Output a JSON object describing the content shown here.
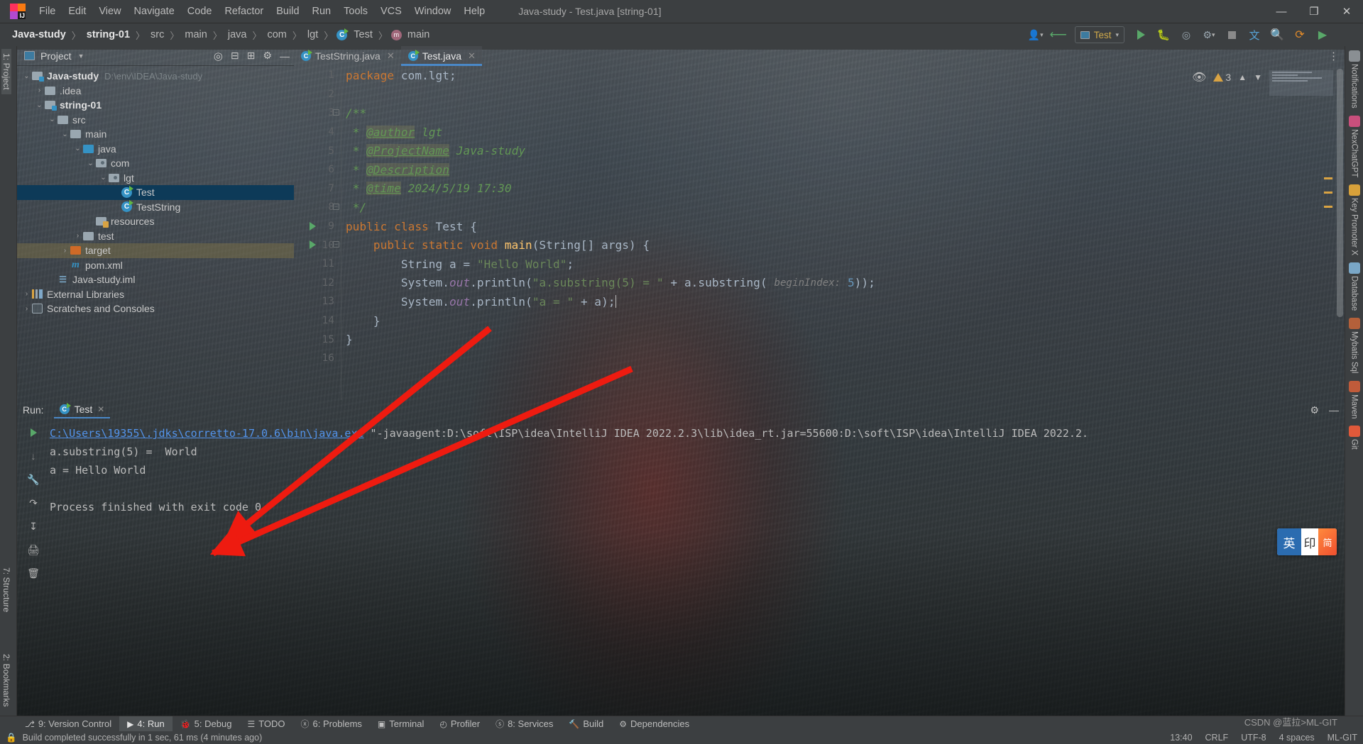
{
  "window": {
    "title": "Java-study - Test.java [string-01]",
    "minimize": "—",
    "maximize": "❐",
    "close": "✕"
  },
  "menubar": {
    "logo_text": "IJ",
    "items": [
      {
        "label": "File"
      },
      {
        "label": "Edit"
      },
      {
        "label": "View"
      },
      {
        "label": "Navigate"
      },
      {
        "label": "Code"
      },
      {
        "label": "Refactor"
      },
      {
        "label": "Build"
      },
      {
        "label": "Run"
      },
      {
        "label": "Tools"
      },
      {
        "label": "VCS"
      },
      {
        "label": "Window"
      },
      {
        "label": "Help"
      }
    ]
  },
  "breadcrumb": {
    "items": [
      "Java-study",
      "string-01",
      "src",
      "main",
      "java",
      "com",
      "lgt",
      "Test",
      "main"
    ],
    "separator": "〉"
  },
  "toolbar": {
    "run_config": "Test",
    "search_icon": "search-icon",
    "settings_icon": "gear-icon",
    "run_icon": "run-icon",
    "debug_icon": "debug-icon",
    "coverage_icon": "coverage-icon",
    "stop_icon": "stop-icon",
    "translate_icon": "translate-icon",
    "updates_icon": "updates-icon"
  },
  "left_strip": {
    "top_label": "1: Project",
    "bottom_labels": [
      "2: Bookmarks",
      "7: Structure"
    ]
  },
  "right_strip": {
    "items": [
      "Notifications",
      "NexChatGPT",
      "Key Promoter X",
      "Database",
      "Mybatis Sql",
      "Maven",
      "Git"
    ]
  },
  "project_panel": {
    "title": "Project",
    "chevron": "▼",
    "header_icons": [
      "locate-icon",
      "expand-all-icon",
      "collapse-all-icon",
      "settings-icon",
      "hide-icon"
    ],
    "tree": [
      {
        "label": "Java-study",
        "path": "D:\\env\\IDEA\\Java-study",
        "depth": 0,
        "twist": "⌄",
        "icon": "module-folder",
        "bold": true
      },
      {
        "label": ".idea",
        "path": "",
        "depth": 1,
        "twist": "›",
        "icon": "folder",
        "bold": false
      },
      {
        "label": "string-01",
        "path": "",
        "depth": 1,
        "twist": "⌄",
        "icon": "module-folder",
        "bold": true
      },
      {
        "label": "src",
        "path": "",
        "depth": 2,
        "twist": "⌄",
        "icon": "folder",
        "bold": false
      },
      {
        "label": "main",
        "path": "",
        "depth": 3,
        "twist": "⌄",
        "icon": "folder",
        "bold": false
      },
      {
        "label": "java",
        "path": "",
        "depth": 4,
        "twist": "⌄",
        "icon": "source-folder",
        "bold": false
      },
      {
        "label": "com",
        "path": "",
        "depth": 5,
        "twist": "⌄",
        "icon": "package-folder",
        "bold": false
      },
      {
        "label": "lgt",
        "path": "",
        "depth": 6,
        "twist": "⌄",
        "icon": "package-folder",
        "bold": false
      },
      {
        "label": "Test",
        "path": "",
        "depth": 7,
        "twist": "",
        "icon": "java-class",
        "bold": false,
        "selected": true
      },
      {
        "label": "TestString",
        "path": "",
        "depth": 7,
        "twist": "",
        "icon": "java-class",
        "bold": false
      },
      {
        "label": "resources",
        "path": "",
        "depth": 5,
        "twist": "",
        "icon": "resources-folder",
        "bold": false
      },
      {
        "label": "test",
        "path": "",
        "depth": 4,
        "twist": "›",
        "icon": "folder",
        "bold": false
      },
      {
        "label": "target",
        "path": "",
        "depth": 3,
        "twist": "›",
        "icon": "target-folder",
        "bold": false,
        "highlighted": true
      },
      {
        "label": "pom.xml",
        "path": "",
        "depth": 3,
        "twist": "",
        "icon": "maven-file",
        "bold": false
      },
      {
        "label": "Java-study.iml",
        "path": "",
        "depth": 2,
        "twist": "",
        "icon": "iml-file",
        "bold": false
      },
      {
        "label": "External Libraries",
        "path": "",
        "depth": 0,
        "twist": "›",
        "icon": "libraries",
        "bold": false
      },
      {
        "label": "Scratches and Consoles",
        "path": "",
        "depth": 0,
        "twist": "›",
        "icon": "scratches",
        "bold": false
      }
    ]
  },
  "editor": {
    "tabs": [
      {
        "label": "TestString.java",
        "active": false,
        "close": "✕"
      },
      {
        "label": "Test.java",
        "active": true,
        "close": "✕"
      }
    ],
    "inspection_widget": {
      "warnings": "3",
      "eye_icon": "eye-off-icon",
      "up_icon": "chevron-up-icon",
      "down_icon": "chevron-down-icon"
    },
    "lines": [
      {
        "n": "1",
        "run": false,
        "fold": "",
        "tokens": [
          {
            "t": "package ",
            "c": "kw"
          },
          {
            "t": "com.lgt;",
            "c": "plain"
          }
        ]
      },
      {
        "n": "2",
        "run": false,
        "fold": "",
        "tokens": []
      },
      {
        "n": "3",
        "run": false,
        "fold": "minus",
        "tokens": [
          {
            "t": "/**",
            "c": "cmt"
          }
        ]
      },
      {
        "n": "4",
        "run": false,
        "fold": "",
        "tokens": [
          {
            "t": " * ",
            "c": "cmt"
          },
          {
            "t": "@author",
            "c": "tagd"
          },
          {
            "t": " lgt",
            "c": "cmt"
          }
        ]
      },
      {
        "n": "5",
        "run": false,
        "fold": "",
        "tokens": [
          {
            "t": " * ",
            "c": "cmt"
          },
          {
            "t": "@ProjectName",
            "c": "tagd"
          },
          {
            "t": " Java-study",
            "c": "cmt"
          }
        ]
      },
      {
        "n": "6",
        "run": false,
        "fold": "",
        "tokens": [
          {
            "t": " * ",
            "c": "cmt"
          },
          {
            "t": "@Description",
            "c": "tagd"
          }
        ]
      },
      {
        "n": "7",
        "run": false,
        "fold": "",
        "tokens": [
          {
            "t": " * ",
            "c": "cmt"
          },
          {
            "t": "@time",
            "c": "tagd"
          },
          {
            "t": " 2024/5/19 17:30",
            "c": "cmt"
          }
        ]
      },
      {
        "n": "8",
        "run": false,
        "fold": "minus",
        "tokens": [
          {
            "t": " */",
            "c": "cmt"
          }
        ]
      },
      {
        "n": "9",
        "run": true,
        "fold": "",
        "tokens": [
          {
            "t": "public class ",
            "c": "kw"
          },
          {
            "t": "Test {",
            "c": "plain"
          }
        ]
      },
      {
        "n": "10",
        "run": true,
        "fold": "minus",
        "tokens": [
          {
            "t": "    public static void ",
            "c": "kw"
          },
          {
            "t": "main",
            "c": "meth"
          },
          {
            "t": "(String[] args) {",
            "c": "plain"
          }
        ]
      },
      {
        "n": "11",
        "run": false,
        "fold": "",
        "tokens": [
          {
            "t": "        String a = ",
            "c": "plain"
          },
          {
            "t": "\"Hello World\"",
            "c": "str"
          },
          {
            "t": ";",
            "c": "plain"
          }
        ]
      },
      {
        "n": "12",
        "run": false,
        "fold": "",
        "tokens": [
          {
            "t": "        System.",
            "c": "plain"
          },
          {
            "t": "out",
            "c": "fld"
          },
          {
            "t": ".println(",
            "c": "plain"
          },
          {
            "t": "\"a.substring(5) = \"",
            "c": "str"
          },
          {
            "t": " + a.substring( ",
            "c": "plain"
          },
          {
            "t": "beginIndex:",
            "c": "hintp"
          },
          {
            "t": " ",
            "c": "plain"
          },
          {
            "t": "5",
            "c": "num"
          },
          {
            "t": "));",
            "c": "plain"
          }
        ]
      },
      {
        "n": "13",
        "run": false,
        "fold": "",
        "tokens": [
          {
            "t": "        System.",
            "c": "plain"
          },
          {
            "t": "out",
            "c": "fld"
          },
          {
            "t": ".println(",
            "c": "plain"
          },
          {
            "t": "\"a = \"",
            "c": "str"
          },
          {
            "t": " + a);",
            "c": "plain"
          }
        ],
        "caret": true
      },
      {
        "n": "14",
        "run": false,
        "fold": "",
        "tokens": [
          {
            "t": "    }",
            "c": "plain"
          }
        ]
      },
      {
        "n": "15",
        "run": false,
        "fold": "",
        "tokens": [
          {
            "t": "}",
            "c": "plain"
          }
        ]
      },
      {
        "n": "16",
        "run": false,
        "fold": "",
        "tokens": []
      }
    ]
  },
  "run_panel": {
    "label": "Run:",
    "tab": "Test",
    "tab_close": "✕",
    "settings_icon": "gear-icon",
    "minimize_icon": "minimize-icon",
    "side_icons": [
      "rerun-icon",
      "wrench-icon",
      "scroll-down-icon",
      "soft-wrap-icon",
      "print-icon",
      "clear-icon"
    ],
    "console": [
      {
        "link": "C:\\Users\\19355\\.jdks\\corretto-17.0.6\\bin\\java.exe",
        "rest": " \"-javaagent:D:\\soft\\ISP\\idea\\IntelliJ IDEA 2022.2.3\\lib\\idea_rt.jar=55600:D:\\soft\\ISP\\idea\\IntelliJ IDEA 2022.2."
      },
      {
        "link": "",
        "rest": "a.substring(5) =  World"
      },
      {
        "link": "",
        "rest": "a = Hello World"
      },
      {
        "link": "",
        "rest": ""
      },
      {
        "link": "",
        "rest": "Process finished with exit code 0"
      }
    ]
  },
  "bottom_bar": {
    "items": [
      {
        "label": "9: Version Control",
        "icon": "branch-icon",
        "active": false
      },
      {
        "label": "4: Run",
        "icon": "run-icon",
        "active": true
      },
      {
        "label": "5: Debug",
        "icon": "debug-icon",
        "active": false
      },
      {
        "label": "TODO",
        "icon": "todo-icon",
        "active": false
      },
      {
        "label": "6: Problems",
        "icon": "problems-icon",
        "active": false
      },
      {
        "label": "Terminal",
        "icon": "terminal-icon",
        "active": false
      },
      {
        "label": "Profiler",
        "icon": "profiler-icon",
        "active": false
      },
      {
        "label": "8: Services",
        "icon": "services-icon",
        "active": false
      },
      {
        "label": "Build",
        "icon": "build-icon",
        "active": false
      },
      {
        "label": "Dependencies",
        "icon": "dependencies-icon",
        "active": false
      }
    ]
  },
  "status_bar": {
    "message": "Build completed successfully in 1 sec, 61 ms (4 minutes ago)",
    "lock_icon": "lock-icon",
    "time": "13:40",
    "line_sep": "CRLF",
    "encoding": "UTF-8",
    "indent": "4 spaces",
    "git_branch": "ML-GIT",
    "watermark": "CSDN @蓝拉>ML-GIT"
  },
  "ime_popup": {
    "a": "英",
    "b": "印",
    "c": "简"
  },
  "colors": {
    "accent_blue": "#4a88c7",
    "selection": "#0d3a58",
    "keyword_orange": "#cc7832",
    "string_green": "#6a8759",
    "comment_green": "#629755",
    "annotation_red": "#e81f12"
  }
}
